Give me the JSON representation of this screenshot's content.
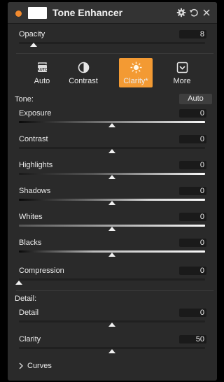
{
  "panel": {
    "title": "Tone Enhancer",
    "dot_color": "#f28a2e",
    "accent": "#f39a33",
    "header_icons": [
      "gear-icon",
      "reset-icon",
      "close-icon"
    ]
  },
  "opacity": {
    "label": "Opacity",
    "value": "8",
    "level": 0.08
  },
  "presets": [
    {
      "label": "Auto",
      "icon": "auto-icon",
      "active": false
    },
    {
      "label": "Contrast",
      "icon": "contrast-icon",
      "active": false
    },
    {
      "label": "Clarity*",
      "icon": "sun-icon",
      "active": true
    },
    {
      "label": "More",
      "icon": "chevron-down-box-icon",
      "active": false
    }
  ],
  "tone": {
    "heading": "Tone:",
    "auto_label": "Auto",
    "sliders": [
      {
        "label": "Exposure",
        "value": "0",
        "level": 0.5
      },
      {
        "label": "Contrast",
        "value": "0",
        "level": 0.5
      },
      {
        "label": "Highlights",
        "value": "0",
        "level": 0.5
      },
      {
        "label": "Shadows",
        "value": "0",
        "level": 0.5
      },
      {
        "label": "Whites",
        "value": "0",
        "level": 0.5
      },
      {
        "label": "Blacks",
        "value": "0",
        "level": 0.5
      },
      {
        "label": "Compression",
        "value": "0",
        "level": 0.0
      }
    ]
  },
  "detail": {
    "heading": "Detail:",
    "sliders": [
      {
        "label": "Detail",
        "value": "0",
        "level": 0.5
      },
      {
        "label": "Clarity",
        "value": "50",
        "level": 0.5
      }
    ]
  },
  "curves": {
    "label": "Curves"
  }
}
